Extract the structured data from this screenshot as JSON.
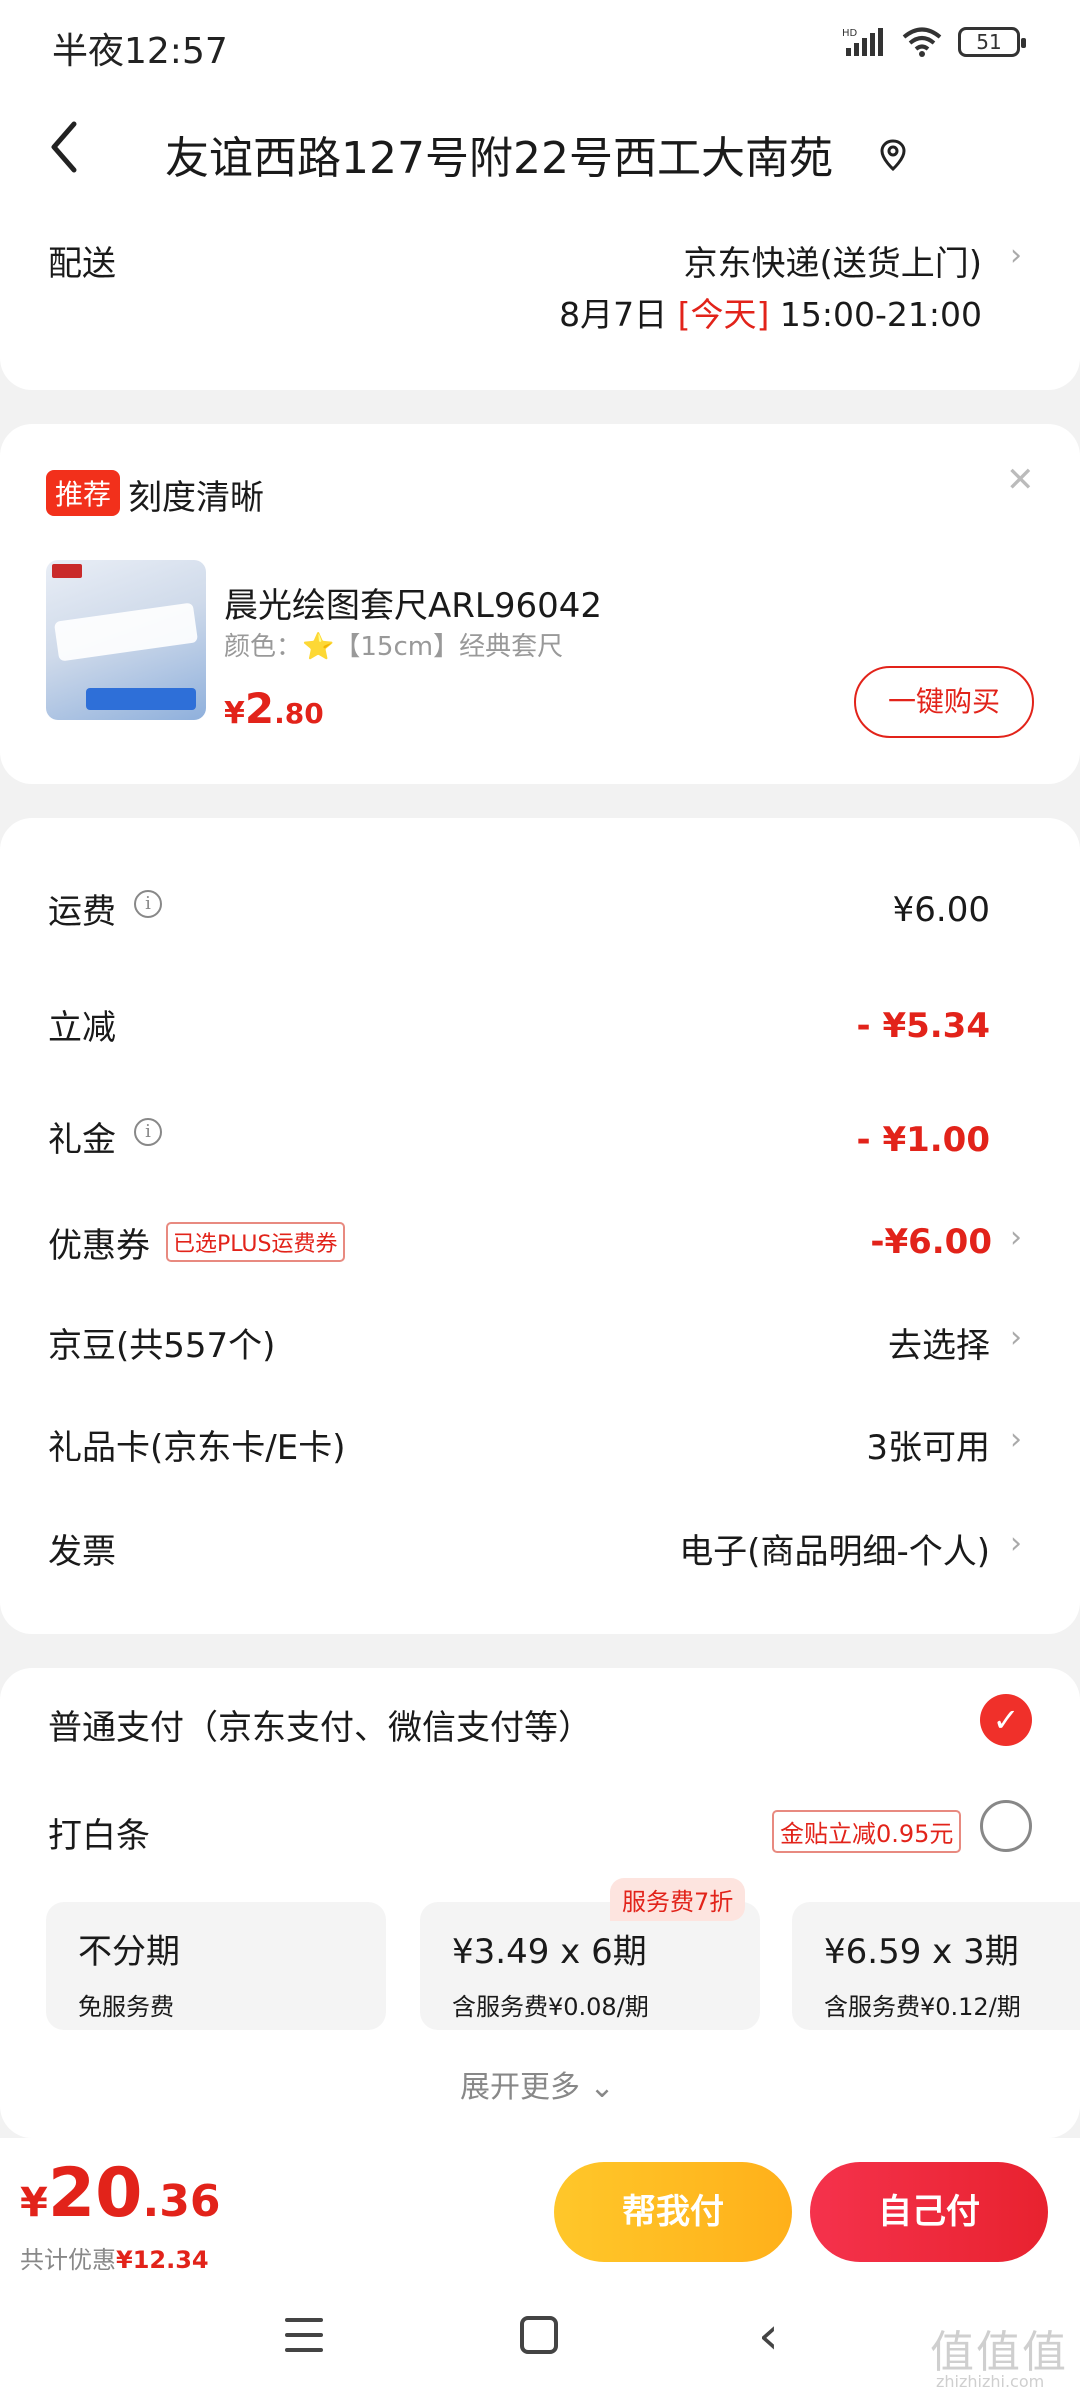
{
  "status_bar": {
    "time": "半夜12:57",
    "battery": "51"
  },
  "header": {
    "back_icon": "‹",
    "address": "友谊西路127号附22号西工大南苑"
  },
  "delivery": {
    "label": "配送",
    "method": "京东快递(送货上门)",
    "date": "8月7日",
    "today": "[今天]",
    "time_window": "15:00-21:00"
  },
  "recommend": {
    "badge": "推荐",
    "title": "刻度清晰",
    "product_name": "晨光绘图套尺ARL96042",
    "spec": "颜色：⭐【15cm】经典套尺",
    "price_currency": "¥",
    "price_int": "2",
    "price_dec": ".80",
    "buy_button": "一键购买"
  },
  "fees": {
    "shipping_label": "运费",
    "shipping_value": "¥6.00",
    "discount_label": "立减",
    "discount_value": "- ¥5.34",
    "cash_gift_label": "礼金",
    "cash_gift_value": "- ¥1.00",
    "coupon_label": "优惠券",
    "coupon_tag": "已选PLUS运费券",
    "coupon_value": "-¥6.00",
    "jingdou_label": "京豆(共557个)",
    "jingdou_value": "去选择",
    "giftcard_label": "礼品卡(京东卡/E卡)",
    "giftcard_value": "3张可用",
    "invoice_label": "发票",
    "invoice_value": "电子(商品明细-个人)"
  },
  "payment": {
    "normal_label": "普通支付（京东支付、微信支付等）",
    "baitiao_label": "打白条",
    "subsidy_tag": "金贴立减0.95元",
    "tiles": [
      {
        "title": "不分期",
        "sub": "免服务费"
      },
      {
        "title": "¥3.49 x 6期",
        "sub": "含服务费¥0.08/期",
        "badge": "服务费7折"
      },
      {
        "title": "¥6.59 x 3期",
        "sub": "含服务费¥0.12/期"
      }
    ],
    "expand": "展开更多 ⌄"
  },
  "bottom": {
    "total_currency": "¥",
    "total_int": "20",
    "total_dec": ".36",
    "saved_prefix": "共计优惠",
    "saved_value": "¥12.34",
    "help_pay": "帮我付",
    "self_pay": "自己付"
  },
  "watermark": {
    "text": "值值值",
    "domain": "zhizhizhi.com"
  },
  "colors": {
    "accent": "#e2231a",
    "pay_yellow": "#ffc72a",
    "pay_red": "#f5324c"
  }
}
